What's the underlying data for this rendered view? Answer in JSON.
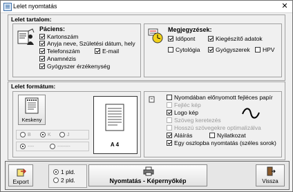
{
  "window": {
    "title": "Lelet nyomtatás",
    "close_label": "✕"
  },
  "content": {
    "title": "Lelet tartalom:",
    "patient": {
      "title": "Páciens:",
      "items": [
        {
          "label": "Kartonszám",
          "checked": true
        },
        {
          "label": "Anyja neve, Születési dátum, hely",
          "checked": true
        },
        {
          "label": "Telefonszám",
          "checked": true
        },
        {
          "label": "E-mail",
          "checked": true
        },
        {
          "label": "Anamnézis",
          "checked": true
        },
        {
          "label": "Gyógyszer érzékenység",
          "checked": true
        }
      ]
    },
    "notes": {
      "title": "Megjegyzések:",
      "items": [
        {
          "label": "Időpont",
          "checked": true
        },
        {
          "label": "Kiegészítő adatok",
          "checked": true
        },
        {
          "label": "Cytológia",
          "checked": false
        },
        {
          "label": "Gyógyszerek",
          "checked": true
        },
        {
          "label": "HPV",
          "checked": false
        }
      ]
    }
  },
  "format": {
    "title": "Lelet formátum:",
    "size_label": "Keskeny",
    "align_options": [
      "B",
      "K",
      "J"
    ],
    "line_options": [
      "----",
      "--------"
    ],
    "paper_label": "A 4",
    "options": [
      {
        "label": "Nyomdában előnyomott fejléces papír",
        "checked": false,
        "enabled": true
      },
      {
        "label": "Fejléc kép",
        "checked": false,
        "enabled": false
      },
      {
        "label": "Logo kép",
        "checked": true,
        "enabled": true
      },
      {
        "label": "Szöveg keretezés",
        "checked": false,
        "enabled": false
      },
      {
        "label": "Hosszú szövegekre optimalizálva",
        "checked": false,
        "enabled": false
      },
      {
        "label": "Aláírás",
        "checked": true,
        "enabled": true
      },
      {
        "label": "Nyilatkozat",
        "checked": false,
        "enabled": true
      },
      {
        "label": "Egy oszlopba nyomtatás (széles sorok)",
        "checked": true,
        "enabled": true
      }
    ]
  },
  "footer": {
    "export_label": "Export",
    "copies": [
      {
        "label": "1 pld.",
        "selected": true
      },
      {
        "label": "2 pld.",
        "selected": false
      }
    ],
    "print_label": "Nyomtatás - Képernyőkép",
    "back_label": "Vissza"
  }
}
